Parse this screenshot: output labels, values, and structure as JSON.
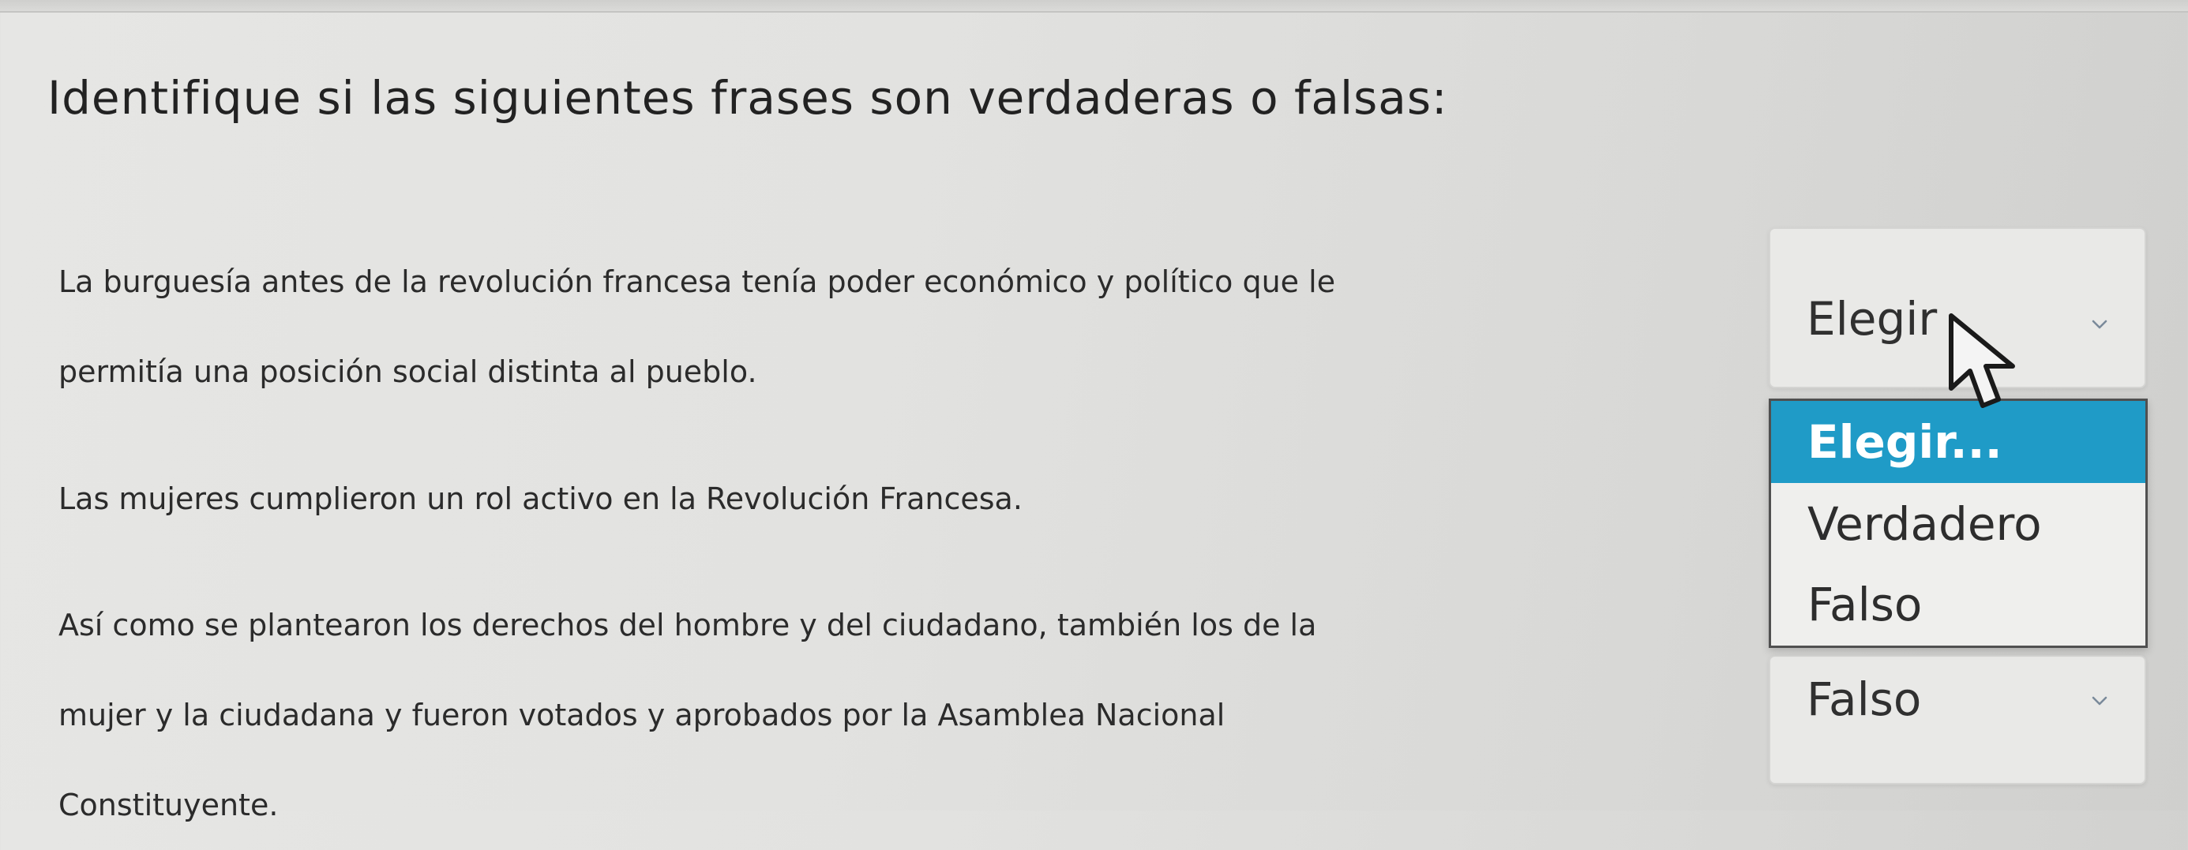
{
  "heading": "Identifique si las siguientes frases son verdaderas o falsas:",
  "questions": [
    {
      "lines": [
        "La burguesía antes de la revolución francesa tenía poder económico y político que le",
        "permitía una posición social distinta al pueblo."
      ],
      "selected": "Elegir"
    },
    {
      "lines": [
        "Las mujeres cumplieron un rol activo en la Revolución Francesa."
      ]
    },
    {
      "lines": [
        "Así como se plantearon los derechos del hombre y del ciudadano, también los de la",
        "mujer y la ciudadana y fueron votados y aprobados por la Asamblea Nacional",
        "Constituyente."
      ],
      "selected": "Falso"
    }
  ],
  "dropdown": {
    "options": [
      "Elegir...",
      "Verdadero",
      "Falso"
    ],
    "highlighted_index": 0
  },
  "colors": {
    "highlight": "#1f9bc7",
    "text": "#2b2b2b",
    "background": "#e2e2e0"
  },
  "icons": {
    "chevron": "chevron-down-icon",
    "cursor": "mouse-pointer-icon"
  }
}
